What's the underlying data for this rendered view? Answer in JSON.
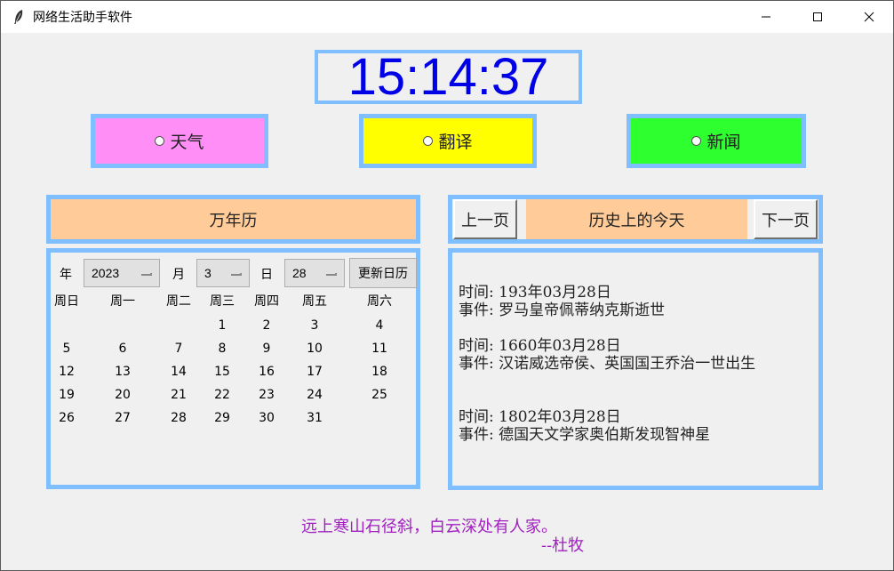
{
  "window": {
    "title": "网络生活助手软件"
  },
  "clock": {
    "time": "15:14:37"
  },
  "modes": [
    {
      "label": "天气",
      "color": "#ff8ff7"
    },
    {
      "label": "翻译",
      "color": "#ffff00"
    },
    {
      "label": "新闻",
      "color": "#2eff2e"
    }
  ],
  "calendar": {
    "title": "万年历",
    "year_label": "年",
    "year_value": "2023",
    "month_label": "月",
    "month_value": "3",
    "day_label": "日",
    "day_value": "28",
    "refresh_label": "更新日历",
    "weekdays": [
      "周日",
      "周一",
      "周二",
      "周三",
      "周四",
      "周五",
      "周六"
    ],
    "weeks": [
      [
        "",
        "",
        "",
        "1",
        "2",
        "3",
        "4"
      ],
      [
        "5",
        "6",
        "7",
        "8",
        "9",
        "10",
        "11"
      ],
      [
        "12",
        "13",
        "14",
        "15",
        "16",
        "17",
        "18"
      ],
      [
        "19",
        "20",
        "21",
        "22",
        "23",
        "24",
        "25"
      ],
      [
        "26",
        "27",
        "28",
        "29",
        "30",
        "31",
        ""
      ]
    ]
  },
  "history": {
    "prev_label": "上一页",
    "title": "历史上的今天",
    "next_label": "下一页",
    "entries": [
      {
        "time": "时间: 193年03月28日",
        "event": "事件: 罗马皇帝佩蒂纳克斯逝世"
      },
      {
        "time": "时间: 1660年03月28日",
        "event": "事件: 汉诺威选帝侯、英国国王乔治一世出生"
      },
      {
        "time": "时间: 1802年03月28日",
        "event": "事件: 德国天文学家奥伯斯发现智神星"
      }
    ]
  },
  "poem": {
    "line1": "远上寒山石径斜，白云深处有人家。",
    "line2": "--杜牧"
  },
  "colors": {
    "panel_border": "#7fbfff",
    "clock_text": "#0000e6",
    "header_bg": "#ffcc99",
    "poem_text": "#a020c0"
  },
  "icons": {
    "app": "feather-icon",
    "minimize": "minimize-icon",
    "maximize": "maximize-icon",
    "close": "close-icon"
  }
}
